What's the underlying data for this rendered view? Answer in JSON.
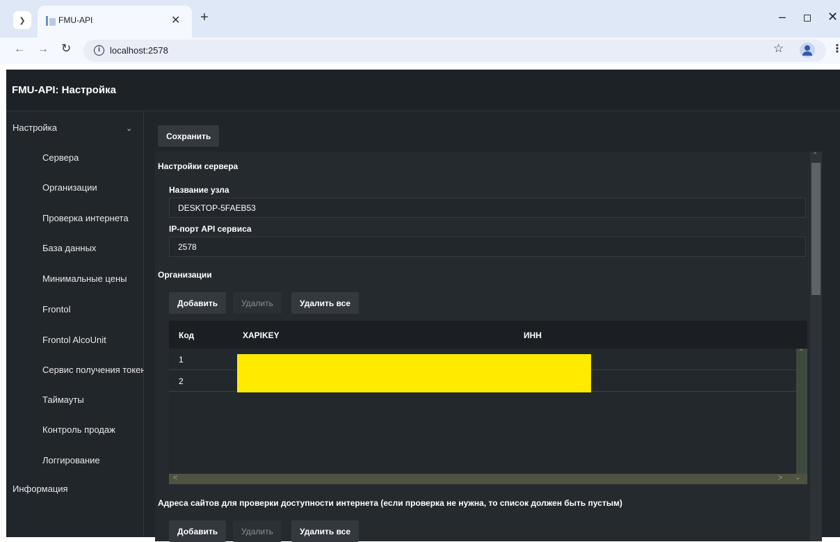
{
  "browser": {
    "tab_title": "FMU-API",
    "url": "localhost:2578"
  },
  "app": {
    "title": "FMU-API: Настройка"
  },
  "sidebar": {
    "group_settings": "Настройка",
    "items": [
      "Сервера",
      "Организации",
      "Проверка интернета",
      "База данных",
      "Минимальные цены",
      "Frontol",
      "Frontol AlcoUnit",
      "Сервис получения токена",
      "Таймауты",
      "Контроль продаж",
      "Логгирование"
    ],
    "group_info": "Информация"
  },
  "main": {
    "save_label": "Сохранить",
    "server_section_title": "Настройки сервера",
    "node_name_label": "Название узла",
    "node_name_value": "DESKTOP-5FAEB53",
    "port_label": "IP-порт API сервиса",
    "port_value": "2578",
    "orgs_section_title": "Организации",
    "add_label": "Добавить",
    "delete_label": "Удалить",
    "delete_all_label": "Удалить все",
    "table": {
      "columns": [
        "Код",
        "XAPIKEY",
        "ИНН"
      ],
      "rows": [
        {
          "code": "1"
        },
        {
          "code": "2"
        }
      ]
    },
    "internet_section_title": "Адреса сайтов для проверки доступности интернета (если проверка не нужна, то список должен быть пустым)"
  },
  "colors": {
    "app_background": "#20252a",
    "button": "#33393f",
    "redaction": "#ffea00"
  }
}
